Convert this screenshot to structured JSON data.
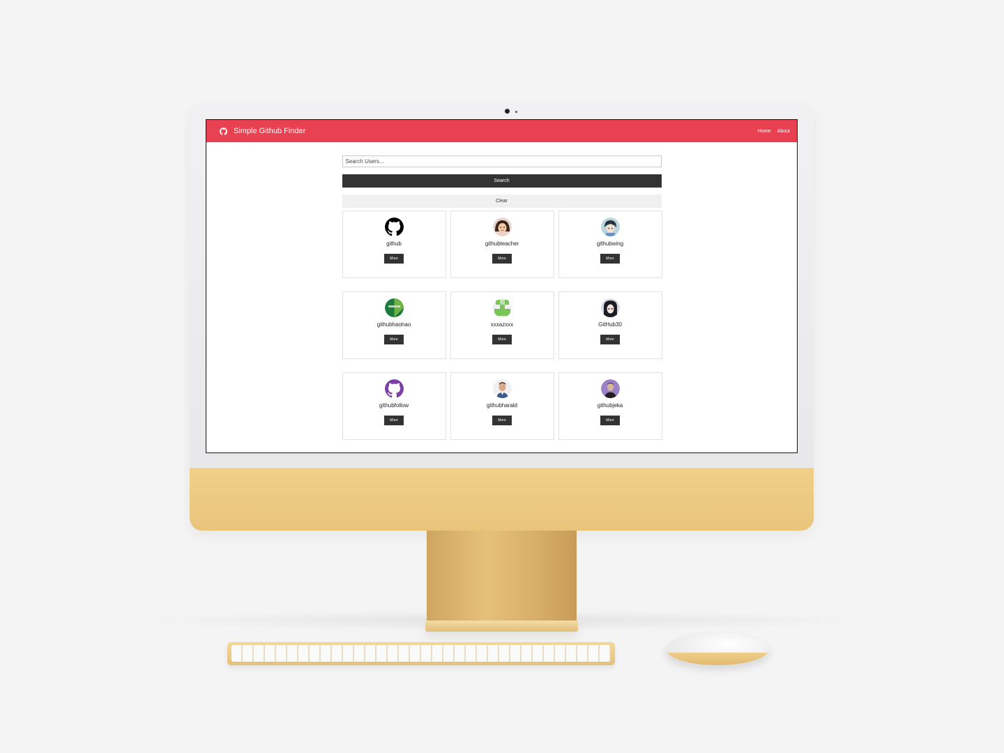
{
  "app": {
    "brand_title": "Simple Github Finder",
    "nav": [
      "Home",
      "About"
    ]
  },
  "search": {
    "placeholder": "Search Users...",
    "value": "",
    "search_label": "Search",
    "clear_label": "Clear"
  },
  "users": [
    {
      "login": "github",
      "more_label": "More",
      "avatar": "github-octocat-black"
    },
    {
      "login": "githubteacher",
      "more_label": "More",
      "avatar": "cartoon-woman"
    },
    {
      "login": "githubwing",
      "more_label": "More",
      "avatar": "anime-boy"
    },
    {
      "login": "githubhaohao",
      "more_label": "More",
      "avatar": "green-chinese-text"
    },
    {
      "login": "xxxazxxx",
      "more_label": "More",
      "avatar": "green-identicon"
    },
    {
      "login": "GitHub30",
      "more_label": "More",
      "avatar": "anime-girl"
    },
    {
      "login": "githubfollow",
      "more_label": "More",
      "avatar": "github-octocat-purple"
    },
    {
      "login": "githubharald",
      "more_label": "More",
      "avatar": "man-photo"
    },
    {
      "login": "githubjeka",
      "more_label": "More",
      "avatar": "man-purple-background"
    }
  ],
  "colors": {
    "navbar": "#e84151",
    "button_dark": "#333333",
    "button_light": "#f0f0f0",
    "chin": "#ecc880"
  },
  "icons": {
    "brand": "github-icon"
  }
}
